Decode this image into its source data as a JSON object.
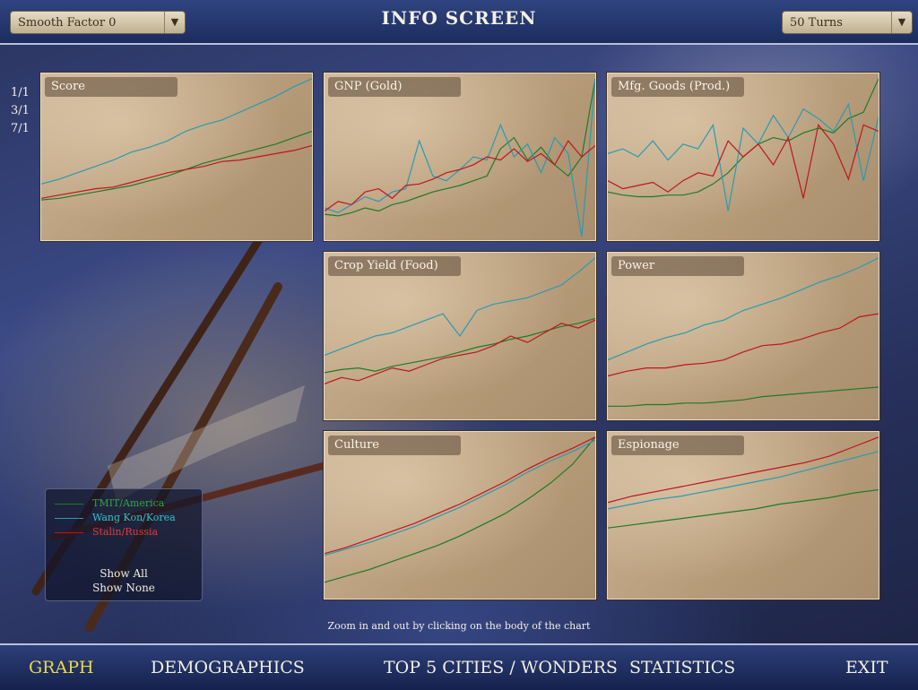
{
  "header": {
    "title": "INFO SCREEN",
    "smooth_factor": "Smooth Factor 0",
    "turns": "50 Turns"
  },
  "ratios": [
    "1/1",
    "3/1",
    "7/1"
  ],
  "colors": {
    "america": "#1f7a2a",
    "korea": "#2a9bb0",
    "russia": "#c0141e"
  },
  "legend": {
    "items": [
      {
        "label": "TMIT/America",
        "color": "#1f7a2a",
        "text_color": "#2fa646"
      },
      {
        "label": "Wang Kon/Korea",
        "color": "#2a9bb0",
        "text_color": "#36c2cf"
      },
      {
        "label": "Stalin/Russia",
        "color": "#c0141e",
        "text_color": "#e03a3a"
      }
    ],
    "show_all": "Show All",
    "show_none": "Show None"
  },
  "hint": "Zoom in and out by clicking on the body of the chart",
  "nav": {
    "graph": "GRAPH",
    "demographics": "DEMOGRAPHICS",
    "top5": "TOP 5 CITIES / WONDERS",
    "statistics": "STATISTICS",
    "exit": "EXIT"
  },
  "panels": [
    {
      "key": "score",
      "label": "Score"
    },
    {
      "key": "gnp",
      "label": "GNP (Gold)"
    },
    {
      "key": "mfg",
      "label": "Mfg. Goods (Prod.)"
    },
    {
      "key": "food",
      "label": "Crop Yield (Food)"
    },
    {
      "key": "power",
      "label": "Power"
    },
    {
      "key": "culture",
      "label": "Culture"
    },
    {
      "key": "espionage",
      "label": "Espionage"
    }
  ],
  "chart_data": [
    {
      "type": "line",
      "title": "Score",
      "ylim": [
        0,
        100
      ],
      "series": [
        {
          "name": "TMIT/America",
          "values": [
            23,
            24,
            26,
            28,
            30,
            32,
            35,
            38,
            42,
            46,
            49,
            52,
            55,
            58,
            62,
            66
          ]
        },
        {
          "name": "Wang Kon/Korea",
          "values": [
            33,
            36,
            40,
            44,
            48,
            53,
            56,
            60,
            66,
            70,
            73,
            78,
            83,
            88,
            94,
            99
          ]
        },
        {
          "name": "Stalin/Russia",
          "values": [
            24,
            26,
            28,
            30,
            31,
            34,
            37,
            40,
            42,
            44,
            47,
            48,
            50,
            52,
            54,
            57
          ]
        }
      ]
    },
    {
      "type": "line",
      "title": "GNP (Gold)",
      "ylim": [
        0,
        100
      ],
      "series": [
        {
          "name": "TMIT/America",
          "values": [
            14,
            13,
            15,
            18,
            16,
            20,
            22,
            25,
            28,
            30,
            32,
            35,
            38,
            55,
            62,
            48,
            56,
            45,
            38,
            50,
            99
          ]
        },
        {
          "name": "Wang Kon/Korea",
          "values": [
            18,
            15,
            20,
            25,
            22,
            28,
            30,
            60,
            38,
            35,
            42,
            50,
            48,
            70,
            50,
            58,
            40,
            62,
            52,
            0,
            99
          ]
        },
        {
          "name": "Stalin/Russia",
          "values": [
            16,
            22,
            20,
            28,
            30,
            24,
            32,
            33,
            36,
            40,
            42,
            45,
            50,
            48,
            55,
            47,
            52,
            45,
            60,
            50,
            57
          ]
        }
      ]
    },
    {
      "type": "line",
      "title": "Mfg. Goods (Prod.)",
      "ylim": [
        0,
        100
      ],
      "series": [
        {
          "name": "TMIT/America",
          "values": [
            28,
            26,
            25,
            25,
            26,
            26,
            28,
            33,
            40,
            50,
            58,
            62,
            60,
            65,
            68,
            65,
            74,
            78,
            99
          ]
        },
        {
          "name": "Wang Kon/Korea",
          "values": [
            52,
            55,
            50,
            60,
            48,
            58,
            55,
            70,
            16,
            68,
            58,
            76,
            62,
            80,
            74,
            66,
            83,
            35,
            75
          ]
        },
        {
          "name": "Stalin/Russia",
          "values": [
            35,
            30,
            32,
            34,
            28,
            35,
            40,
            38,
            60,
            50,
            58,
            45,
            62,
            24,
            70,
            58,
            36,
            70,
            66
          ]
        }
      ]
    },
    {
      "type": "line",
      "title": "Crop Yield (Food)",
      "ylim": [
        0,
        100
      ],
      "series": [
        {
          "name": "TMIT/America",
          "values": [
            27,
            29,
            30,
            28,
            31,
            33,
            35,
            37,
            40,
            43,
            45,
            48,
            50,
            53,
            56,
            58,
            61
          ]
        },
        {
          "name": "Wang Kon/Korea",
          "values": [
            38,
            42,
            46,
            50,
            52,
            56,
            60,
            64,
            50,
            66,
            70,
            72,
            74,
            78,
            82,
            90,
            99
          ]
        },
        {
          "name": "Stalin/Russia",
          "values": [
            20,
            24,
            22,
            26,
            30,
            28,
            32,
            36,
            38,
            40,
            44,
            50,
            46,
            52,
            58,
            55,
            60
          ]
        }
      ]
    },
    {
      "type": "line",
      "title": "Power",
      "ylim": [
        0,
        100
      ],
      "series": [
        {
          "name": "TMIT/America",
          "values": [
            6,
            6,
            7,
            7,
            8,
            8,
            9,
            10,
            12,
            13,
            14,
            15,
            16,
            17,
            18
          ]
        },
        {
          "name": "Wang Kon/Korea",
          "values": [
            35,
            40,
            45,
            49,
            52,
            57,
            60,
            66,
            70,
            74,
            79,
            84,
            88,
            93,
            99
          ]
        },
        {
          "name": "Stalin/Russia",
          "values": [
            25,
            28,
            30,
            30,
            32,
            33,
            35,
            40,
            44,
            45,
            48,
            52,
            55,
            62,
            64
          ]
        }
      ]
    },
    {
      "type": "line",
      "title": "Culture",
      "ylim": [
        0,
        100
      ],
      "series": [
        {
          "name": "TMIT/America",
          "values": [
            8,
            12,
            16,
            21,
            26,
            31,
            37,
            44,
            51,
            60,
            70,
            82,
            99
          ]
        },
        {
          "name": "Wang Kon/Korea",
          "values": [
            25,
            29,
            33,
            38,
            43,
            49,
            55,
            62,
            69,
            77,
            84,
            90,
            97
          ]
        },
        {
          "name": "Stalin/Russia",
          "values": [
            26,
            30,
            35,
            40,
            45,
            51,
            57,
            64,
            71,
            79,
            86,
            92,
            99
          ]
        }
      ]
    },
    {
      "type": "line",
      "title": "Espionage",
      "ylim": [
        0,
        100
      ],
      "series": [
        {
          "name": "TMIT/America",
          "values": [
            42,
            44,
            46,
            48,
            50,
            52,
            54,
            57,
            59,
            61,
            64,
            66
          ]
        },
        {
          "name": "Wang Kon/Korea",
          "values": [
            54,
            57,
            60,
            62,
            65,
            68,
            71,
            74,
            78,
            82,
            86,
            90
          ]
        },
        {
          "name": "Stalin/Russia",
          "values": [
            58,
            62,
            65,
            68,
            71,
            74,
            77,
            80,
            83,
            87,
            93,
            99
          ]
        }
      ]
    }
  ]
}
